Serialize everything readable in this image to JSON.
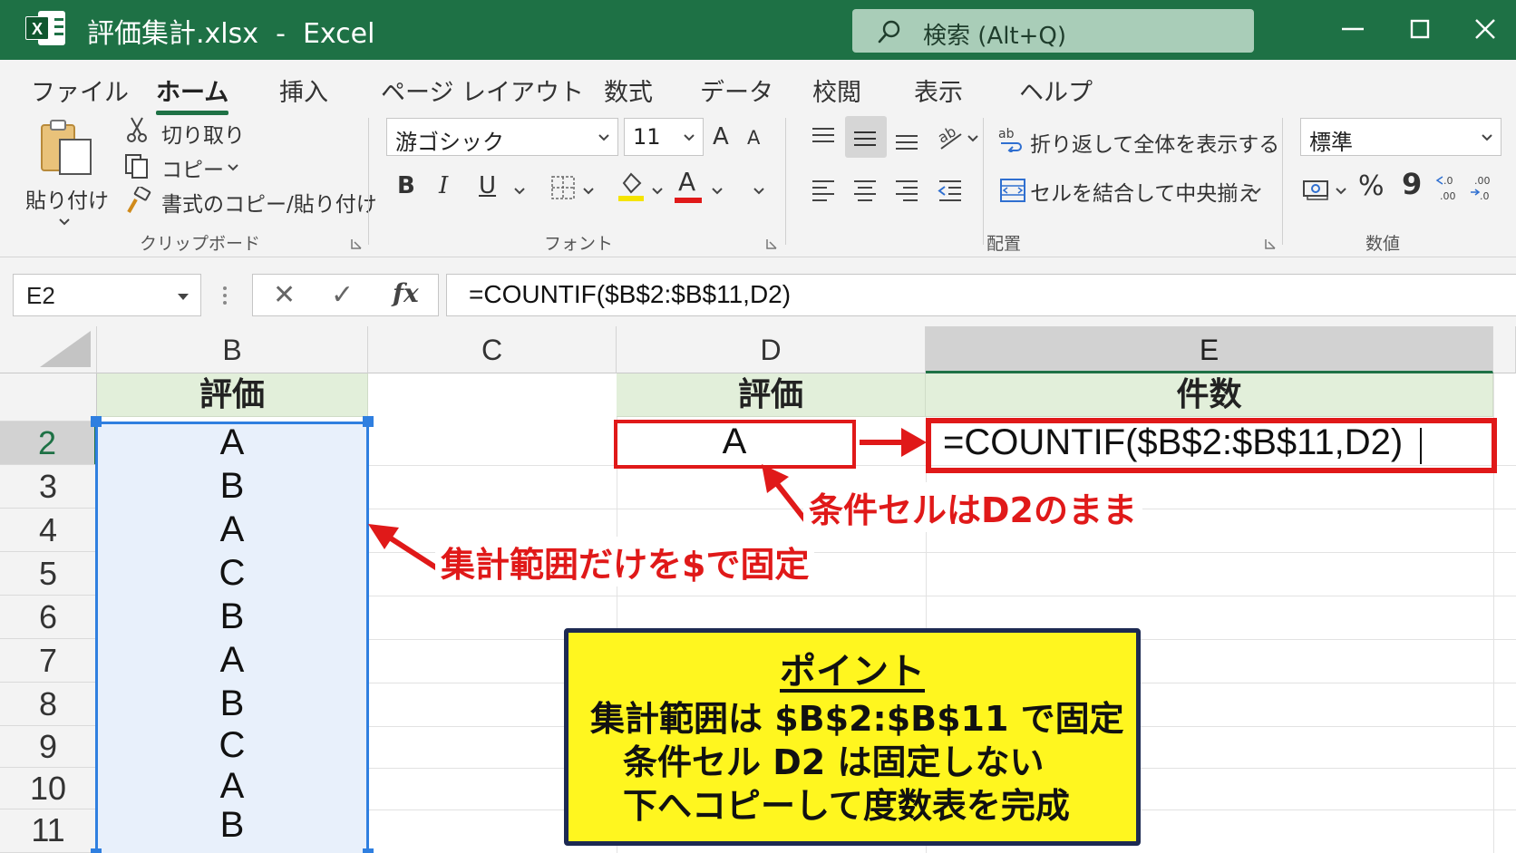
{
  "window": {
    "title": "評価集計.xlsx  -  Excel",
    "app_letter": "X",
    "search_placeholder": "検索 (Alt+Q)",
    "accent_color": "#1e7145"
  },
  "ribbon": {
    "tabs": [
      "ファイル",
      "ホーム",
      "挿入",
      "ページ レイアウト",
      "数式",
      "データ",
      "校閲",
      "表示",
      "ヘルプ"
    ],
    "active_tab": "ホーム",
    "clipboard": {
      "paste": "貼り付け",
      "cut": "切り取り",
      "copy": "コピー",
      "format_painter": "書式のコピー/貼り付け",
      "group": "クリップボード"
    },
    "font": {
      "name": "游ゴシック",
      "size": "11",
      "grow": "A",
      "shrink": "A",
      "bold": "B",
      "italic": "I",
      "underline": "U",
      "font_color_letter": "A",
      "group": "フォント"
    },
    "alignment": {
      "wrap_text": "折り返して全体を表示する",
      "merge_center": "セルを結合して中央揃え",
      "group": "配置"
    },
    "number": {
      "format": "標準",
      "percent": "%",
      "comma": "9",
      "group": "数値"
    }
  },
  "formula_bar": {
    "name_box": "E2",
    "cancel": "✕",
    "enter": "✓",
    "fx": "fx",
    "formula": "=COUNTIF($B$2:$B$11,D2)"
  },
  "sheet": {
    "columns": [
      "B",
      "C",
      "D",
      "E"
    ],
    "selected_column": "E",
    "row_numbers": [
      "2",
      "3",
      "4",
      "5",
      "6",
      "7",
      "8",
      "9",
      "10",
      "11"
    ],
    "selected_row": "2",
    "header_b": "評価",
    "header_d": "評価",
    "header_e": "件数",
    "b_values": [
      "A",
      "B",
      "A",
      "C",
      "B",
      "A",
      "B",
      "C",
      "A",
      "B"
    ],
    "d2": "A",
    "e2_formula": "=COUNTIF($B$2:$B$11,D2)"
  },
  "annotations": {
    "condition_note": "条件セルはD2のまま",
    "range_note": "集計範囲だけを$で固定",
    "highlight_color": "#e01919"
  },
  "point_box": {
    "title": "ポイント",
    "lines": [
      "集計範囲は $B$2:$B$11 で固定",
      "条件セル D2 は固定しない",
      "下へコピーして度数表を完成"
    ],
    "background": "#fff61f"
  }
}
